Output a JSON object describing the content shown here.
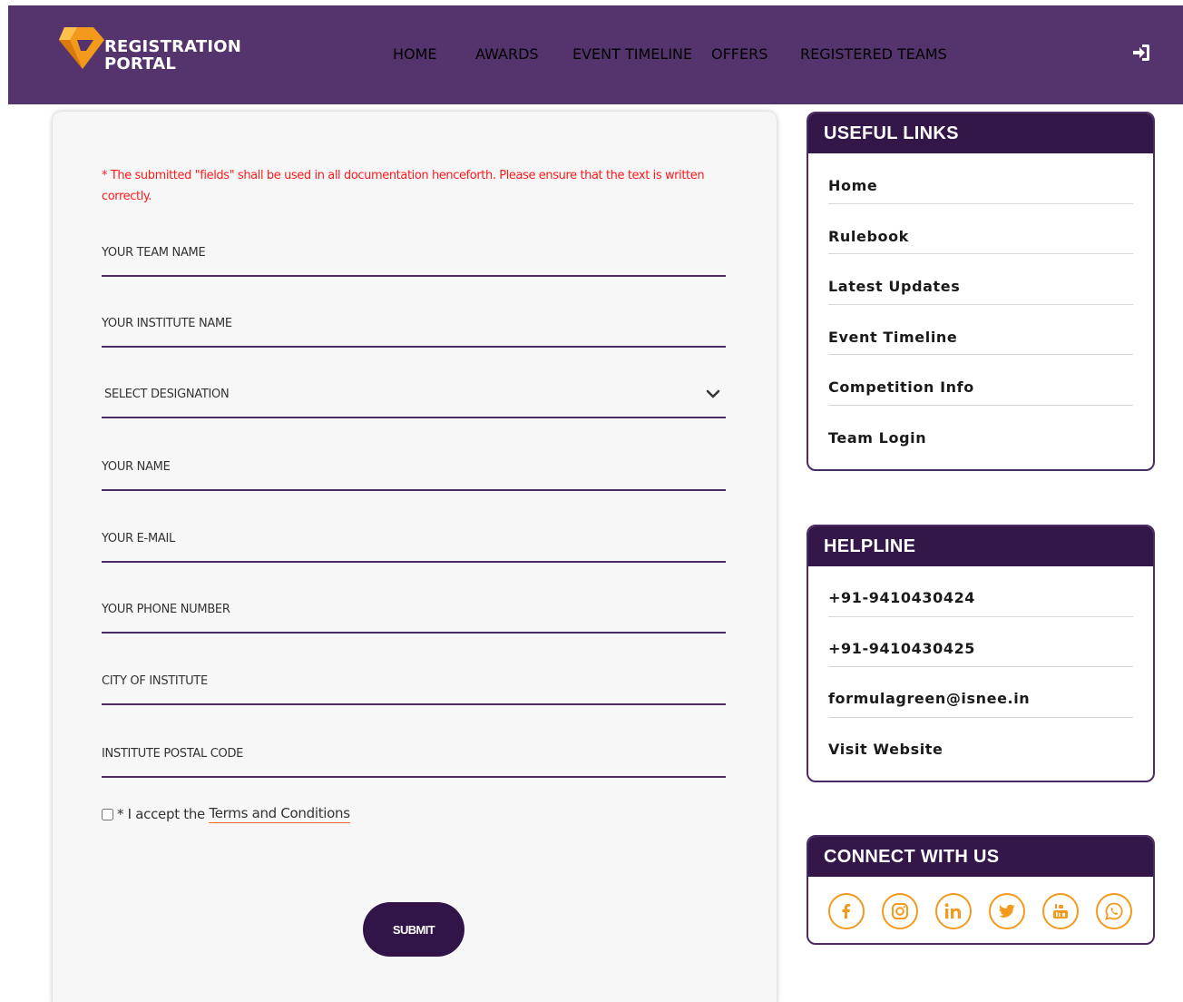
{
  "brand": {
    "line1": "REGISTRATION",
    "line2": "PORTAL"
  },
  "nav": {
    "home": "HOME",
    "awards": "AWARDS",
    "event_timeline": "EVENT TIMELINE",
    "offers": "OFFERS",
    "registered_teams": "REGISTERED TEAMS"
  },
  "form": {
    "notice": "* The submitted \"fields\" shall be used in all documentation henceforth. Please ensure that the text is written correctly.",
    "team_name": "YOUR TEAM NAME",
    "institute_name": "YOUR INSTITUTE NAME",
    "designation": "SELECT DESIGNATION",
    "your_name": "YOUR NAME",
    "email": "YOUR E-MAIL",
    "phone": "YOUR PHONE NUMBER",
    "city": "CITY OF INSTITUTE",
    "postal": "INSTITUTE POSTAL CODE",
    "terms_prefix": "* I accept the",
    "terms_link": "Terms and Conditions",
    "submit": "SUBMIT"
  },
  "useful_links": {
    "title": "USEFUL LINKS",
    "items": [
      "Home",
      "Rulebook",
      "Latest Updates",
      "Event Timeline",
      "Competition Info",
      "Team Login"
    ]
  },
  "helpline": {
    "title": "HELPLINE",
    "items": [
      "+91-9410430424",
      "+91-9410430425",
      "formulagreen@isnee.in",
      "Visit Website"
    ]
  },
  "connect": {
    "title": "CONNECT WITH US"
  },
  "colors": {
    "header": "#55346d",
    "box_head": "#341749",
    "accent": "#f39a1d",
    "notice": "#ff1a1a"
  },
  "icons": [
    "logo-icon",
    "sign-in-icon",
    "chevron-down-icon",
    "facebook-icon",
    "instagram-icon",
    "linkedin-icon",
    "twitter-icon",
    "youtube-icon",
    "whatsapp-icon"
  ]
}
